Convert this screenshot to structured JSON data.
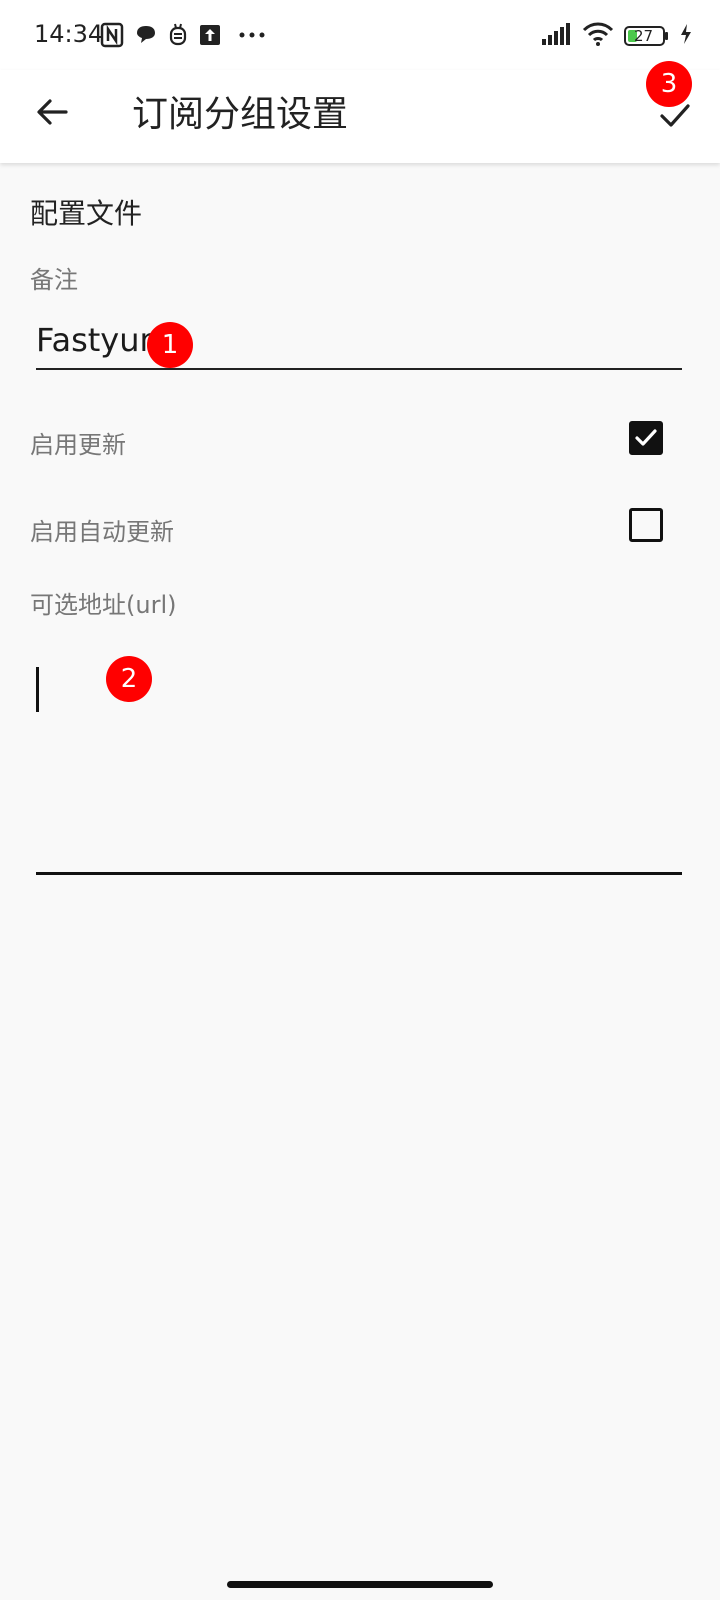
{
  "status_bar": {
    "time": "14:34",
    "battery": "27",
    "icons": [
      "nfc-icon",
      "chat-icon",
      "bug-icon",
      "upload-icon",
      "more-icon",
      "signal-icon",
      "wifi-icon",
      "battery-icon",
      "charging-icon"
    ]
  },
  "appbar": {
    "title": "订阅分组设置",
    "back_icon": "arrow-left-icon",
    "confirm_icon": "check-icon"
  },
  "section": {
    "title": "配置文件"
  },
  "remark": {
    "label": "备注",
    "value": "Fastyun"
  },
  "settings": [
    {
      "label": "启用更新",
      "checked": true
    },
    {
      "label": "启用自动更新",
      "checked": false
    }
  ],
  "url": {
    "label": "可选地址(url)",
    "value": ""
  },
  "markers": [
    "1",
    "2",
    "3"
  ],
  "colors": {
    "marker": "#ff0000",
    "background": "#f9f9f9",
    "battery_fill": "#4cc84c"
  }
}
